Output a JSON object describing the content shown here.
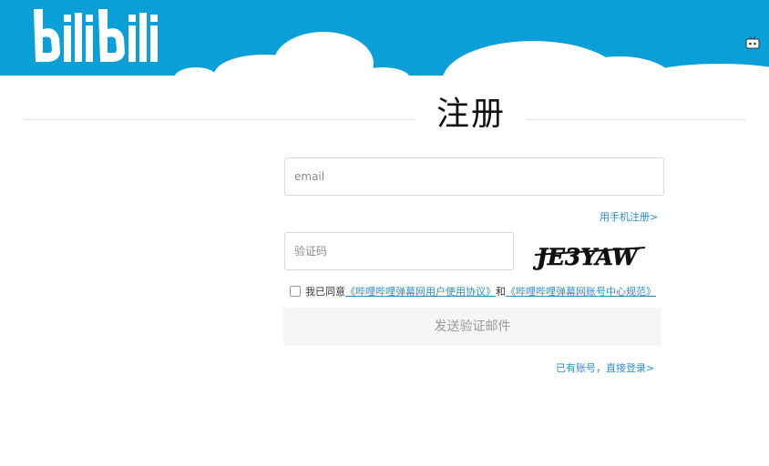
{
  "brand": {
    "logo_text": "bilibili",
    "header_color": "#0b9fd8"
  },
  "page": {
    "title": "注册"
  },
  "form": {
    "email_placeholder": "email",
    "captcha_placeholder": "验证码",
    "phone_register_link": "用手机注册>",
    "captcha_image_text": "JE3YAW",
    "agreement": {
      "prefix": "我已同意",
      "link1": "《哔哩哔哩弹幕网用户使用协议》",
      "conjunction": "和",
      "link2": "《哔哩哔哩弹幕网账号中心规范》"
    },
    "send_button": "发送验证邮件",
    "login_link": "已有账号，直接登录>"
  },
  "icons": {
    "header_corner": "tv-mascot-icon",
    "checkbox": "checkbox-icon"
  },
  "colors": {
    "link": "#2a8fcf",
    "button_bg": "#f5f5f5",
    "button_text": "#9a9a9a"
  }
}
